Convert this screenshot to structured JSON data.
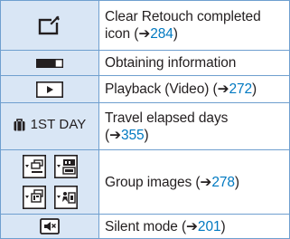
{
  "rows": [
    {
      "icon": "clear-retouch-completed-icon",
      "desc_lines": [
        "Clear Retouch completed",
        "icon ("
      ],
      "ref": "284",
      "close": ")"
    },
    {
      "icon": "obtaining-information-icon",
      "desc": "Obtaining information"
    },
    {
      "icon": "playback-video-icon",
      "desc": "Playback (Video) (",
      "ref": "272",
      "close": ")"
    },
    {
      "icon": "travel-suitcase-icon",
      "icon_label": "1ST DAY",
      "desc_lines": [
        "Travel elapsed days",
        "("
      ],
      "ref": "355",
      "close": ")"
    },
    {
      "icons": [
        "group-burst-icon",
        "group-4k-icon",
        "group-focus-stacking-icon",
        "group-interval-icon"
      ],
      "desc": "Group images (",
      "ref": "278",
      "close": ")"
    },
    {
      "icon": "silent-mode-icon",
      "desc": "Silent mode (",
      "ref": "201",
      "close": ")"
    }
  ],
  "arrow": "➔",
  "colors": {
    "ref": "#0079c1",
    "border": "#6f9fcf",
    "icon_bg": "#d9e6f5"
  }
}
